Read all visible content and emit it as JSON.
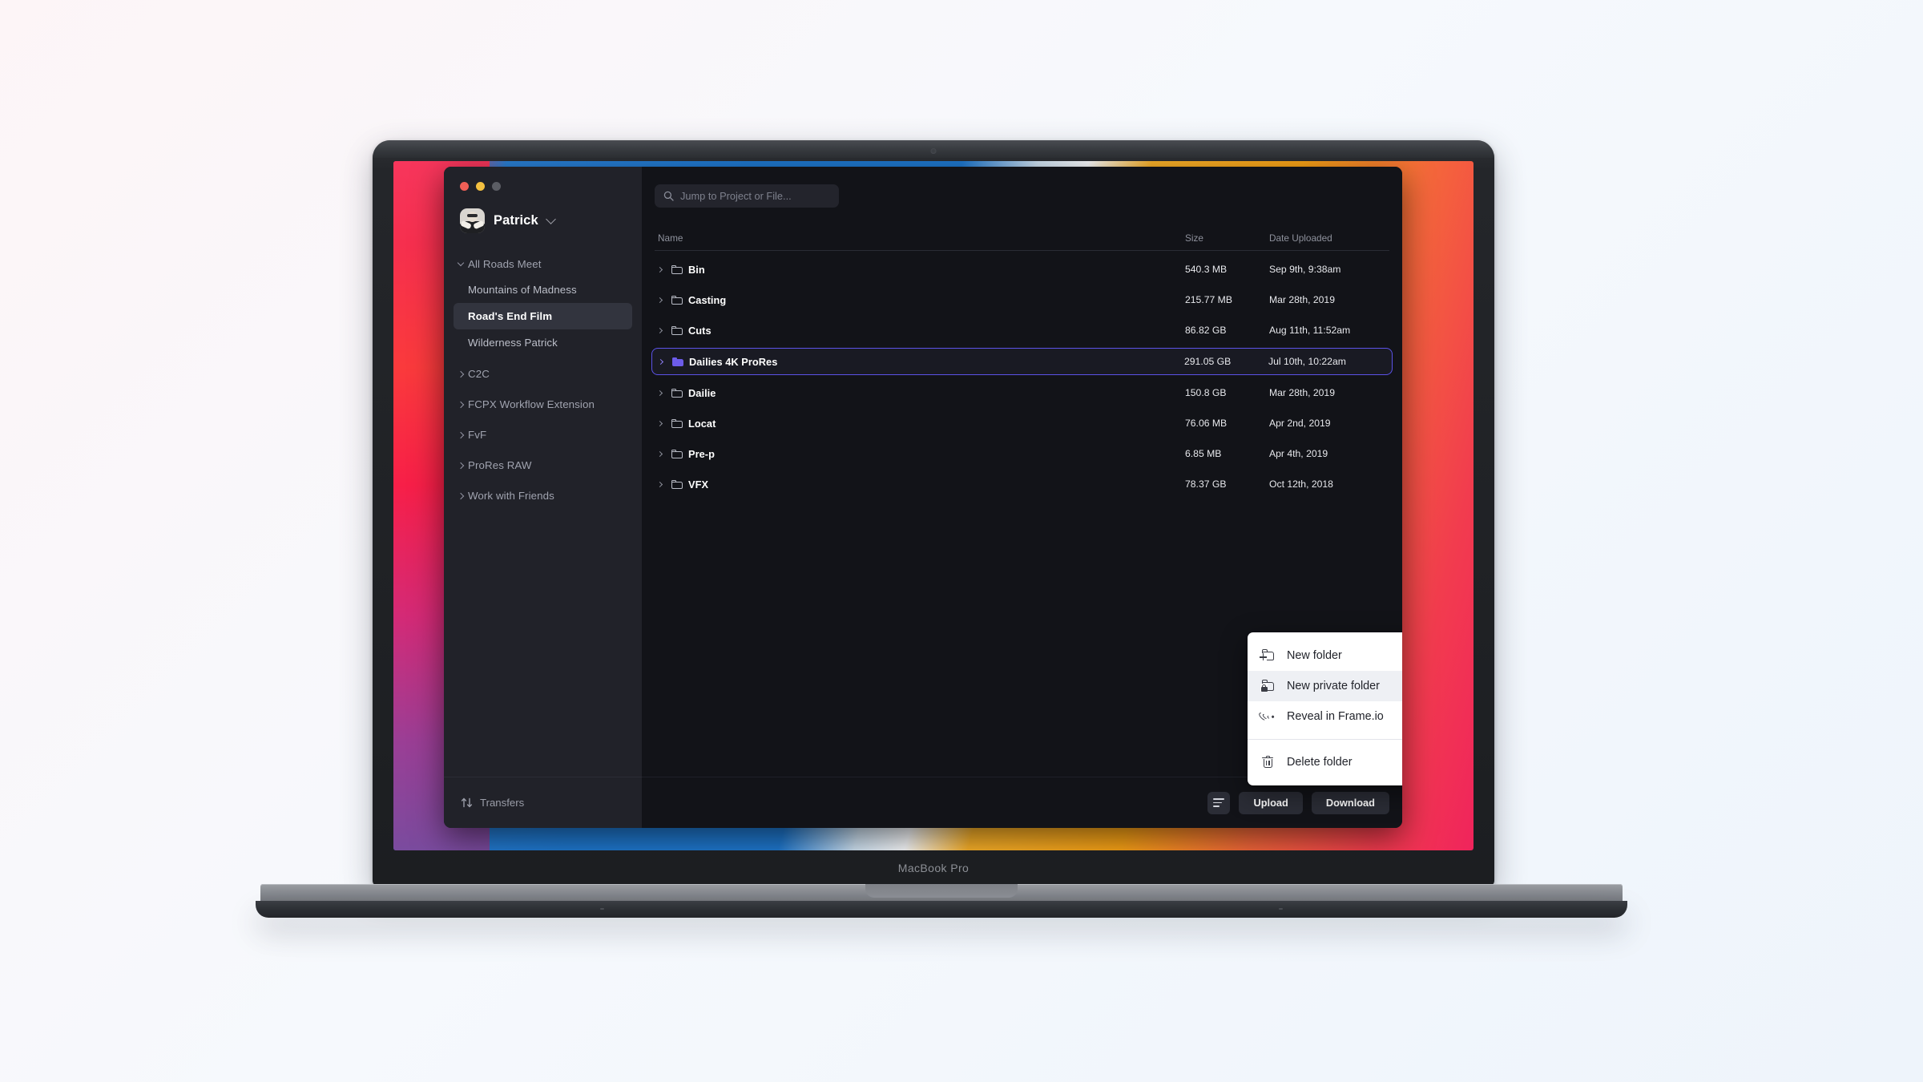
{
  "device": {
    "model_label": "MacBook Pro"
  },
  "app": {
    "window_controls": [
      "close",
      "minimize",
      "zoom"
    ],
    "account": {
      "name": "Patrick",
      "avatar": "user-avatar",
      "chevron": "chevron-down-icon"
    },
    "sidebar": {
      "items": [
        {
          "label": "All Roads Meet",
          "type": "group",
          "expanded": true,
          "selected": false
        },
        {
          "label": "Mountains of Madness",
          "type": "child",
          "selected": false
        },
        {
          "label": "Road's End Film",
          "type": "child",
          "selected": true
        },
        {
          "label": "Wilderness Patrick",
          "type": "child",
          "selected": false
        },
        {
          "label": "C2C",
          "type": "group",
          "expanded": false,
          "selected": false
        },
        {
          "label": "FCPX Workflow Extension",
          "type": "group",
          "expanded": false,
          "selected": false
        },
        {
          "label": "FvF",
          "type": "group",
          "expanded": false,
          "selected": false
        },
        {
          "label": "ProRes RAW",
          "type": "group",
          "expanded": false,
          "selected": false
        },
        {
          "label": "Work with Friends",
          "type": "group",
          "expanded": false,
          "selected": false
        }
      ],
      "transfers": {
        "label": "Transfers",
        "icon": "transfers-arrows-icon"
      }
    },
    "search": {
      "placeholder": "Jump to Project or File...",
      "value": "",
      "icon": "search-icon"
    },
    "table": {
      "columns": [
        "Name",
        "Size",
        "Date Uploaded"
      ],
      "rows": [
        {
          "name": "Bin",
          "size": "540.3 MB",
          "date": "Sep 9th, 9:38am",
          "selected": false
        },
        {
          "name": "Casting",
          "size": "215.77 MB",
          "date": "Mar 28th, 2019",
          "selected": false
        },
        {
          "name": "Cuts",
          "size": "86.82 GB",
          "date": "Aug 11th, 11:52am",
          "selected": false
        },
        {
          "name": "Dailies 4K ProRes",
          "size": "291.05 GB",
          "date": "Jul 10th, 10:22am",
          "selected": true
        },
        {
          "name": "Dailie",
          "size": "150.8 GB",
          "date": "Mar 28th, 2019",
          "selected": false
        },
        {
          "name": "Locat",
          "size": "76.06 MB",
          "date": "Apr 2nd, 2019",
          "selected": false
        },
        {
          "name": "Pre-p",
          "size": "6.85 MB",
          "date": "Apr 4th, 2019",
          "selected": false
        },
        {
          "name": "VFX",
          "size": "78.37 GB",
          "date": "Oct 12th, 2018",
          "selected": false
        }
      ]
    },
    "bottom_bar": {
      "view_toggle": "list-view-icon",
      "upload_label": "Upload",
      "download_label": "Download"
    },
    "context_menu": {
      "items": [
        {
          "label": "New folder",
          "icon": "folder-plus-icon",
          "active": false
        },
        {
          "label": "New private folder",
          "icon": "folder-lock-icon",
          "active": true
        },
        {
          "label": "Reveal in Frame.io",
          "icon": "broadcast-wave-icon",
          "active": false
        },
        {
          "label": "Delete folder",
          "icon": "trash-icon",
          "active": false
        }
      ],
      "separator_after_index": 2,
      "cursor": "pointing-hand-cursor"
    },
    "colors": {
      "accent": "#5b52e8",
      "folder_selected": "#6c5ce9",
      "sidebar_bg": "#212229",
      "main_bg": "#121318",
      "menu_bg": "#ffffff"
    }
  }
}
